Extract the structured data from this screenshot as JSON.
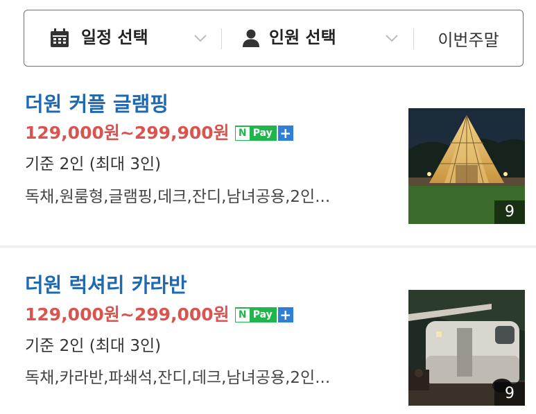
{
  "filter_bar": {
    "date_label": "일정 선택",
    "people_label": "인원 선택",
    "weekend_label": "이번주말"
  },
  "listings": [
    {
      "title": "더원 커플 글램핑",
      "price": "129,000원~299,900원",
      "npay_n": "N",
      "npay_text": "Pay",
      "npay_plus": "+",
      "capacity": "기준 2인 (최대 3인)",
      "tags": "독채,원룸형,글램핑,데크,잔디,남녀공용,2인...",
      "photo_count": "9"
    },
    {
      "title": "더원 럭셔리 카라반",
      "price": "129,000원~299,000원",
      "npay_n": "N",
      "npay_text": "Pay",
      "npay_plus": "+",
      "capacity": "기준 2인 (최대 3인)",
      "tags": "독채,카라반,파쇄석,잔디,데크,남녀공용,2인...",
      "photo_count": "9"
    }
  ],
  "colors": {
    "title": "#1f68b2",
    "price": "#d9534f",
    "npay_green": "#1fb74b",
    "npay_blue": "#2f7fd6"
  },
  "icons": {
    "date": "calendar-icon",
    "people": "person-icon",
    "dropdown": "chevron-down-icon"
  }
}
